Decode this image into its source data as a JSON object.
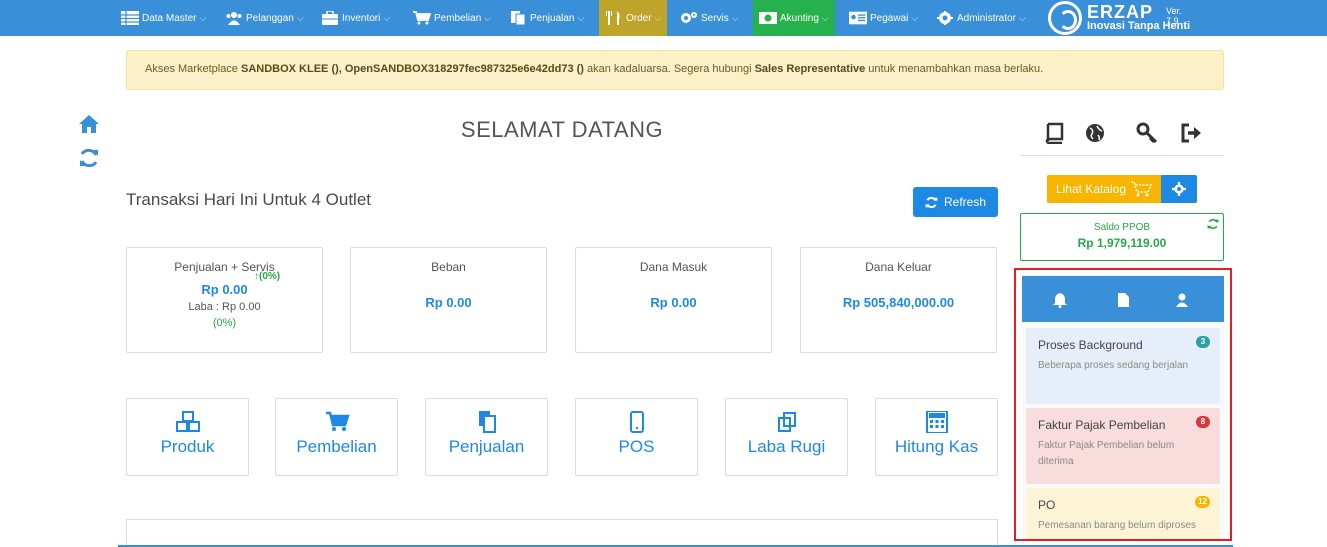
{
  "nav": {
    "items": [
      {
        "label": "Data Master",
        "icon": "table-icon"
      },
      {
        "label": "Pelanggan",
        "icon": "users-icon"
      },
      {
        "label": "Inventori",
        "icon": "briefcase-icon"
      },
      {
        "label": "Pembelian",
        "icon": "cart-icon"
      },
      {
        "label": "Penjualan",
        "icon": "copy-icon"
      },
      {
        "label": "Order",
        "icon": "utensils-icon"
      },
      {
        "label": "Servis",
        "icon": "gears-icon"
      },
      {
        "label": "Akunting",
        "icon": "money-icon"
      },
      {
        "label": "Pegawai",
        "icon": "id-card-icon"
      },
      {
        "label": "Administrator",
        "icon": "gear-icon"
      }
    ],
    "brand_name": "ERZAP",
    "brand_tagline": "Inovasi Tanpa Henti",
    "version": "Ver. 7.9",
    "colors": {
      "nav": "#3a8fd9",
      "order": "#bfa42a",
      "akunting": "#26b14c"
    }
  },
  "alert": {
    "prefix": "Akses Marketplace ",
    "accounts": "SANDBOX KLEE (), OpenSANDBOX318297fec987325e6e42dd73 ()",
    "middle": " akan kadaluarsa. Segera hubungi ",
    "contact": "Sales Representative",
    "suffix": " untuk menambahkan masa berlaku."
  },
  "main": {
    "welcome": "SELAMAT DATANG",
    "transactions_title": "Transaksi Hari Ini Untuk 4 Outlet",
    "refresh_label": "Refresh",
    "stats": {
      "sales": {
        "label": "Penjualan + Servis",
        "trend": "(0%)",
        "value": "Rp 0.00",
        "profit": "Laba : Rp 0.00",
        "profit_pct": "(0%)"
      },
      "expense": {
        "label": "Beban",
        "value": "Rp 0.00"
      },
      "inflow": {
        "label": "Dana Masuk",
        "value": "Rp 0.00"
      },
      "outflow": {
        "label": "Dana Keluar",
        "value": "Rp 505,840,000.00"
      }
    },
    "shortcuts": [
      {
        "label": "Produk",
        "icon": "cubes-icon"
      },
      {
        "label": "Pembelian",
        "icon": "cart-icon"
      },
      {
        "label": "Penjualan",
        "icon": "copy-icon"
      },
      {
        "label": "POS",
        "icon": "tablet-icon"
      },
      {
        "label": "Laba Rugi",
        "icon": "clone-icon"
      },
      {
        "label": "Hitung Kas",
        "icon": "calculator-icon"
      }
    ]
  },
  "right": {
    "catalog_label": "Lihat Katalog",
    "ppob_label": "Saldo PPOB",
    "ppob_value": "Rp 1,979,119.00",
    "notifications": [
      {
        "title": "Proses Background",
        "desc": "Beberapa proses sedang berjalan",
        "count": "3",
        "bg": "#e6eff9",
        "badge": "#2aa1a6"
      },
      {
        "title": "Faktur Pajak Pembelian",
        "desc": "Faktur Pajak Pembelian belum diterima",
        "count": "8",
        "bg": "#f9dcdc",
        "badge": "#d9363e"
      },
      {
        "title": "PO",
        "desc": "Pemesanan barang belum diproses",
        "count": "12",
        "bg": "#fdf4d6",
        "badge": "#f8b500"
      }
    ]
  }
}
